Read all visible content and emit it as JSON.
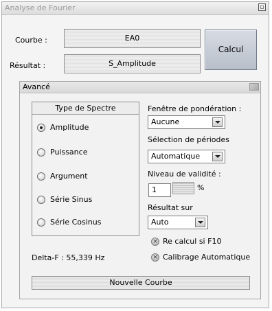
{
  "window": {
    "title": "Analyse de Fourier"
  },
  "curve": {
    "label": "Courbe :",
    "value": "EA0"
  },
  "result": {
    "label": "Résultat :",
    "value": "S_Amplitude"
  },
  "calcul_button": "Calcul",
  "advanced": {
    "title": "Avancé",
    "spectrum_group": {
      "title": "Type de Spectre",
      "options": [
        "Amplitude",
        "Puissance",
        "Argument",
        "Série Sinus",
        "Série Cosinus"
      ],
      "selected": "Amplitude"
    },
    "window_weighting": {
      "label": "Fenêtre de pondération :",
      "value": "Aucune"
    },
    "period_selection": {
      "label": "Sélection de périodes",
      "value": "Automatique"
    },
    "validity_level": {
      "label": "Niveau de validité :",
      "value": "1",
      "unit": "%"
    },
    "result_on": {
      "label": "Résultat sur",
      "value": "Auto"
    },
    "checks": {
      "recalc": "Re calcul si F10",
      "calibration": "Calibrage Automatique"
    },
    "delta_f": "Delta-F : 55,339 Hz"
  },
  "new_curve_button": "Nouvelle Courbe"
}
